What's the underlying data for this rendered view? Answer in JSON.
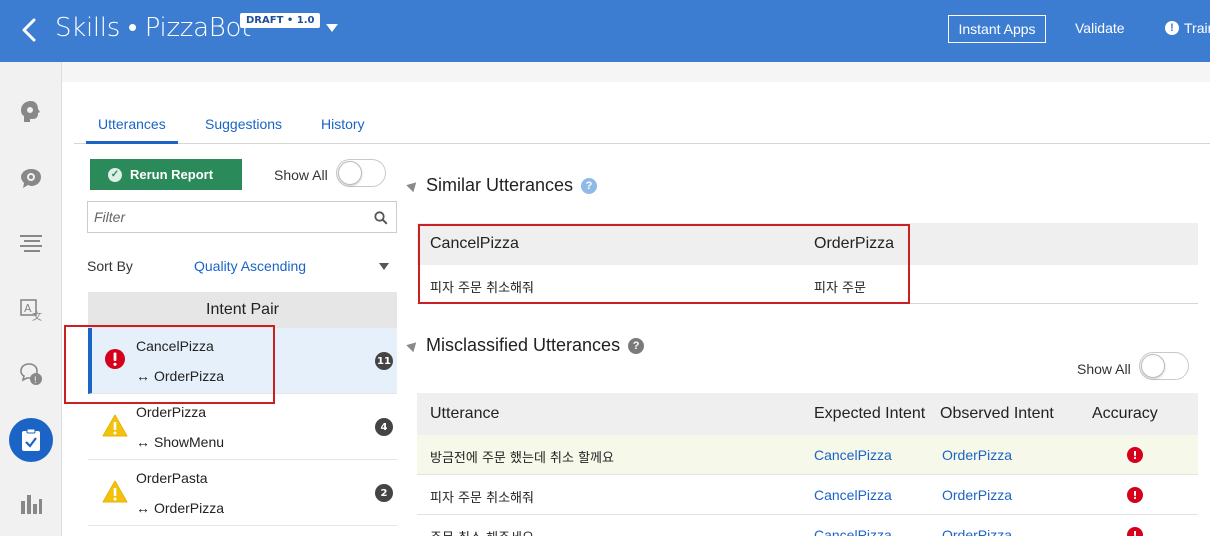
{
  "header": {
    "title": "Skills • PizzaBot",
    "version_badge": "DRAFT • 1.0",
    "instant_apps_label": "Instant Apps",
    "validate_label": "Validate",
    "train_label": "Train"
  },
  "rail": {
    "items": [
      {
        "icon": "intents-icon"
      },
      {
        "icon": "entities-icon"
      },
      {
        "icon": "flows-icon"
      },
      {
        "icon": "resource-bundles-icon"
      },
      {
        "icon": "qna-icon"
      },
      {
        "icon": "quality-report-icon",
        "active": true
      },
      {
        "icon": "insights-icon"
      }
    ]
  },
  "tabs": [
    {
      "label": "Utterances",
      "active": true
    },
    {
      "label": "Suggestions"
    },
    {
      "label": "History"
    }
  ],
  "left": {
    "rerun_label": "Rerun Report",
    "show_all_label": "Show All",
    "filter_placeholder": "Filter",
    "sort_by_label": "Sort By",
    "sort_by_value": "Quality Ascending",
    "intent_pair_header": "Intent Pair",
    "pairs": [
      {
        "first": "CancelPizza",
        "second": "OrderPizza",
        "count": "11",
        "status": "error",
        "selected": true
      },
      {
        "first": "OrderPizza",
        "second": "ShowMenu",
        "count": "4",
        "status": "warning"
      },
      {
        "first": "OrderPasta",
        "second": "OrderPizza",
        "count": "2",
        "status": "warning"
      }
    ]
  },
  "similar": {
    "title": "Similar Utterances",
    "headers": [
      "CancelPizza",
      "OrderPizza"
    ],
    "row": [
      "피자 주문 취소해줘",
      "피자 주문"
    ]
  },
  "misclassified": {
    "title": "Misclassified Utterances",
    "show_all_label": "Show All",
    "headers": {
      "utterance": "Utterance",
      "expected": "Expected Intent",
      "observed": "Observed Intent",
      "accuracy": "Accuracy"
    },
    "rows": [
      {
        "utterance": "방금전에 주문 했는데 취소 할께요",
        "expected": "CancelPizza",
        "observed": "OrderPizza"
      },
      {
        "utterance": "피자 주문 취소해줘",
        "expected": "CancelPizza",
        "observed": "OrderPizza"
      },
      {
        "utterance": "주문 취소 해주세요",
        "expected": "CancelPizza",
        "observed": "OrderPizza"
      }
    ]
  },
  "colors": {
    "header_bg": "#3c7dd1",
    "accent": "#1b64c6",
    "rerun_bg": "#2b8a5a",
    "error": "#d6001c",
    "warning": "#f3c20c",
    "highlight_box": "#cc1f1f"
  }
}
